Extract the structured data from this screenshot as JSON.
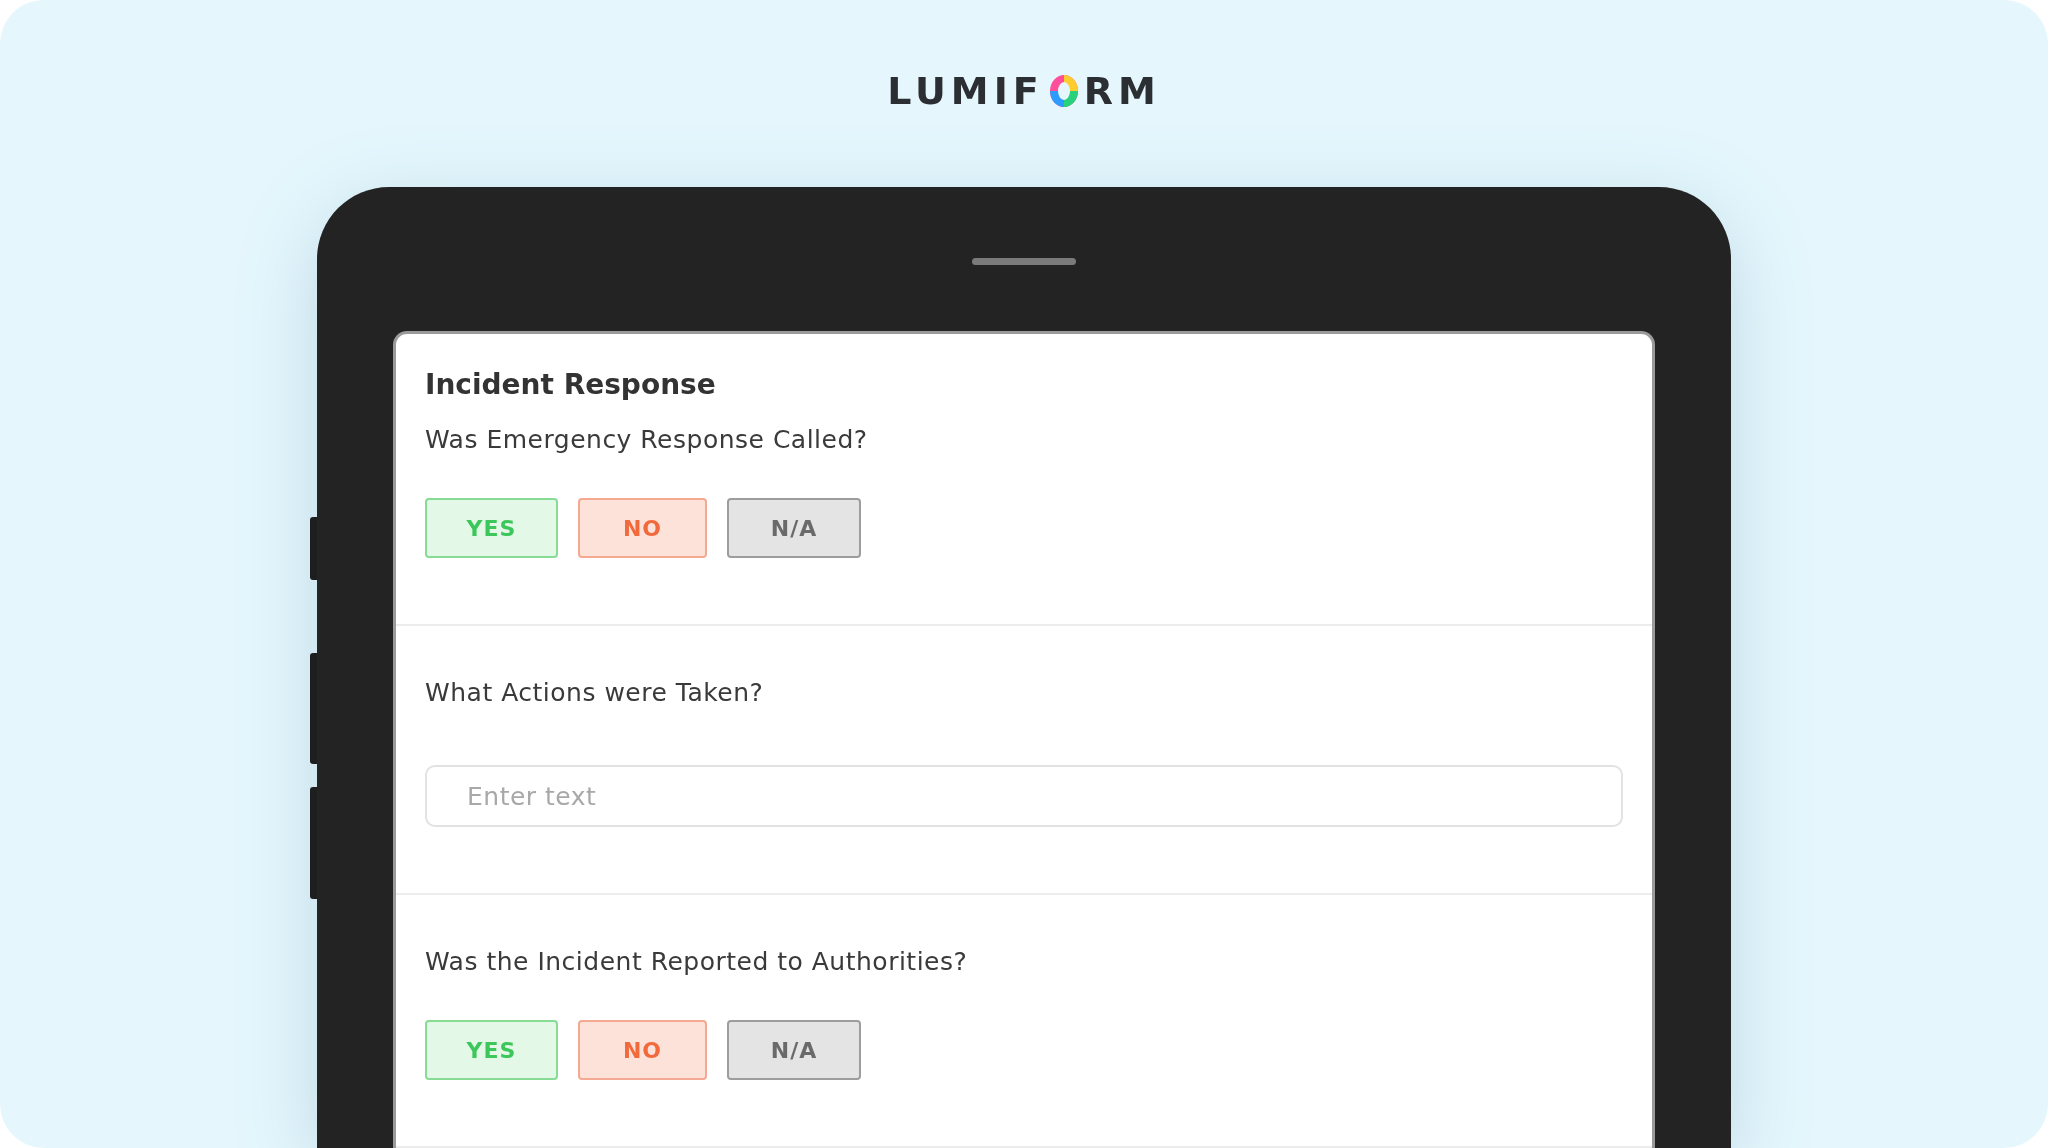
{
  "logo": {
    "before": "LUMIF",
    "after": "RM"
  },
  "form": {
    "title": "Incident Response",
    "questions": [
      {
        "kind": "choice",
        "label": "Was Emergency Response Called?",
        "options": [
          {
            "label": "YES",
            "kind": "yes"
          },
          {
            "label": "NO",
            "kind": "no"
          },
          {
            "label": "N/A",
            "kind": "na"
          }
        ]
      },
      {
        "kind": "text",
        "label": "What Actions were Taken?",
        "placeholder": "Enter text"
      },
      {
        "kind": "choice",
        "label": "Was the Incident Reported to Authorities?",
        "options": [
          {
            "label": "YES",
            "kind": "yes"
          },
          {
            "label": "NO",
            "kind": "no"
          },
          {
            "label": "N/A",
            "kind": "na"
          }
        ]
      }
    ]
  }
}
